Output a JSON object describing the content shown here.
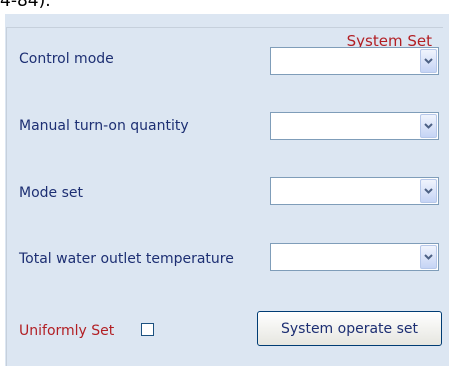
{
  "top_fragment": "4-84).",
  "panel": {
    "title": "System Set",
    "rows": [
      {
        "label": "Control mode",
        "value": ""
      },
      {
        "label": "Manual turn-on quantity",
        "value": ""
      },
      {
        "label": "Mode set",
        "value": ""
      },
      {
        "label": "Total water outlet temperature",
        "value": ""
      }
    ],
    "uniformly_set_label": "Uniformly Set",
    "uniformly_set_checked": false,
    "operate_button_label": "System operate set"
  },
  "icons": {
    "dropdown": "chevron-down-icon"
  },
  "colors": {
    "panel_bg": "#dce6f2",
    "label_text": "#1d2f73",
    "accent_red": "#b21f24",
    "select_border": "#7f9db9"
  }
}
